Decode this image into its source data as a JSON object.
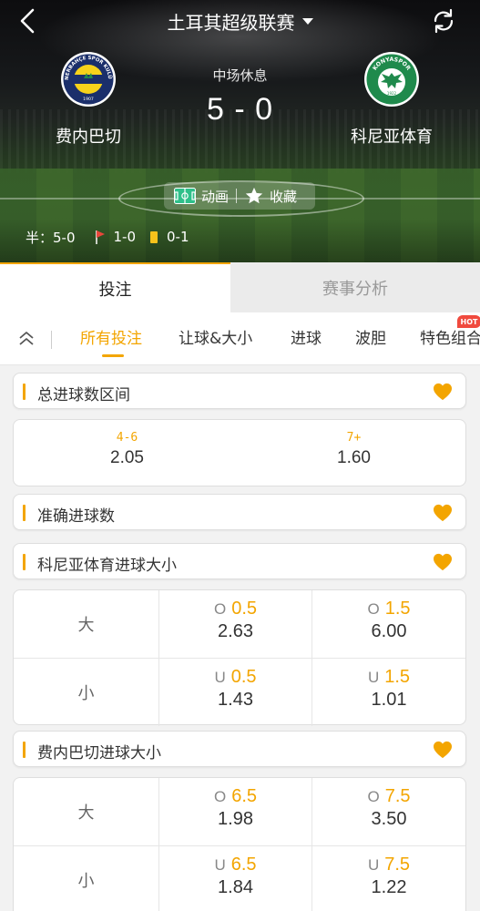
{
  "header": {
    "league_title": "土耳其超级联赛",
    "home_team": "费内巴切",
    "away_team": "科尼亚体育",
    "status": "中场休息",
    "score": "5 - 0",
    "actions": {
      "animation": "动画",
      "favorite": "收藏"
    },
    "stats": {
      "half_label": "半：5-0",
      "corners": "1-0",
      "yellow_cards": "0-1"
    },
    "home_logo_text": "FENERBAHÇE SPOR KULÜBÜ",
    "home_logo_year": "1907",
    "away_logo_text": "KONYASPOR",
    "away_logo_year": "1922"
  },
  "main_tabs": [
    {
      "label": "投注",
      "active": true
    },
    {
      "label": "赛事分析",
      "active": false
    }
  ],
  "sub_tabs": [
    {
      "label": "所有投注",
      "active": true
    },
    {
      "label": "让球&大小",
      "active": false
    },
    {
      "label": "进球",
      "active": false
    },
    {
      "label": "波胆",
      "active": false
    },
    {
      "label": "特色组合",
      "active": false
    }
  ],
  "hot_badge": "HOT",
  "markets": {
    "total_goals_range": {
      "title": "总进球数区间",
      "options": [
        {
          "label": "4-6",
          "odd": "2.05"
        },
        {
          "label": "7+",
          "odd": "1.60"
        }
      ]
    },
    "exact_goals": {
      "title": "准确进球数"
    },
    "away_goals_ou": {
      "title": "科尼亚体育进球大小",
      "rows": [
        {
          "side": "大",
          "cells": [
            {
              "prefix": "O",
              "line": "0.5",
              "odd": "2.63"
            },
            {
              "prefix": "O",
              "line": "1.5",
              "odd": "6.00"
            }
          ]
        },
        {
          "side": "小",
          "cells": [
            {
              "prefix": "U",
              "line": "0.5",
              "odd": "1.43"
            },
            {
              "prefix": "U",
              "line": "1.5",
              "odd": "1.01"
            }
          ]
        }
      ]
    },
    "home_goals_ou": {
      "title": "费内巴切进球大小",
      "rows": [
        {
          "side": "大",
          "cells": [
            {
              "prefix": "O",
              "line": "6.5",
              "odd": "1.98"
            },
            {
              "prefix": "O",
              "line": "7.5",
              "odd": "3.50"
            }
          ]
        },
        {
          "side": "小",
          "cells": [
            {
              "prefix": "U",
              "line": "6.5",
              "odd": "1.84"
            },
            {
              "prefix": "U",
              "line": "7.5",
              "odd": "1.22"
            }
          ]
        }
      ]
    }
  },
  "colors": {
    "accent": "#f3a500",
    "hot": "#f04a3e",
    "home_navy": "#1b2f6b",
    "home_yellow": "#f7d21b",
    "away_green": "#1f8a4c"
  },
  "icons": [
    "back-icon",
    "caret-down-icon",
    "refresh-icon",
    "pitch-icon",
    "star-icon",
    "corner-flag-icon",
    "yellow-card-icon",
    "collapse-up-icon",
    "heart-icon"
  ]
}
